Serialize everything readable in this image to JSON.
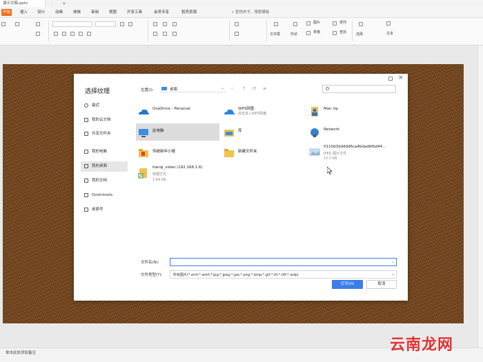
{
  "window": {
    "doc_tab": "演示文稿.pptx"
  },
  "menu": {
    "items": [
      "开始",
      "插入",
      "设计",
      "动画",
      "放映",
      "审阅",
      "视图",
      "开发工具",
      "会员专享",
      "稻壳资源"
    ],
    "search": "查找命令、搜索模板"
  },
  "ribbon": {
    "labels": [
      "文本框",
      "形状",
      "图片",
      "表格",
      "排列",
      "查找",
      "选择",
      "文本"
    ]
  },
  "dialog": {
    "title": "选择纹理",
    "location_label": "位置(I):",
    "location_value": "桌面",
    "sidebar": [
      {
        "label": "最近",
        "icon": "clock-icon"
      },
      {
        "label": "我的云文档",
        "icon": "cloud-icon"
      },
      {
        "label": "共享文件夹",
        "icon": "share-icon"
      },
      {
        "label": "我的电脑",
        "icon": "computer-icon"
      },
      {
        "label": "我的桌面",
        "icon": "desktop-icon"
      },
      {
        "label": "我的文档",
        "icon": "document-icon"
      },
      {
        "label": "Downloads",
        "icon": "download-icon"
      },
      {
        "label": "桌面号",
        "icon": "folder-icon"
      }
    ],
    "files": [
      {
        "name": "OneDrive - Personal",
        "sub1": "",
        "sub2": "",
        "icon": "onedrive-icon"
      },
      {
        "name": "WPS网盘",
        "sub1": "双击进入WPS网盘",
        "sub2": "",
        "icon": "wps-cloud-icon"
      },
      {
        "name": "Man Up",
        "sub1": "",
        "sub2": "",
        "icon": "user-folder-icon"
      },
      {
        "name": "此电脑",
        "sub1": "",
        "sub2": "",
        "icon": "this-pc-icon"
      },
      {
        "name": "库",
        "sub1": "",
        "sub2": "",
        "icon": "library-icon"
      },
      {
        "name": "Network",
        "sub1": "",
        "sub2": "",
        "icon": "network-icon"
      },
      {
        "name": "传统新年小报",
        "sub1": "",
        "sub2": "",
        "icon": "folder-icon"
      },
      {
        "name": "新建文件夹",
        "sub1": "",
        "sub2": "",
        "icon": "folder-icon"
      },
      {
        "name": "0110d3ddddd6ca4bdadbfbd44...",
        "sub1": "JPEG 图片文件",
        "sub2": "15.5 KB",
        "icon": "image-file-icon"
      },
      {
        "name": "tianqi_video (192.168.1.6)",
        "sub1": "快捷方式",
        "sub2": "1.64 KB",
        "icon": "shortcut-icon"
      }
    ],
    "filename_label": "文件名(N):",
    "filename_value": "",
    "filetype_label": "文件类型(T):",
    "filetype_value": "所有图片(*.emf;*.wmf;*.jpg;*.jpeg;*.jpe;*.png;*.bmp;*.gif;*.tif;*.tiff;*.wdp)",
    "open_label": "打开(O)",
    "cancel_label": "取消"
  },
  "status": {
    "text": "单击此处添加备注"
  },
  "watermark": {
    "text": "云南龙网"
  },
  "colors": {
    "accent": "#3b7de9",
    "tab_active": "#f06a1a",
    "watermark": "#e23030"
  }
}
